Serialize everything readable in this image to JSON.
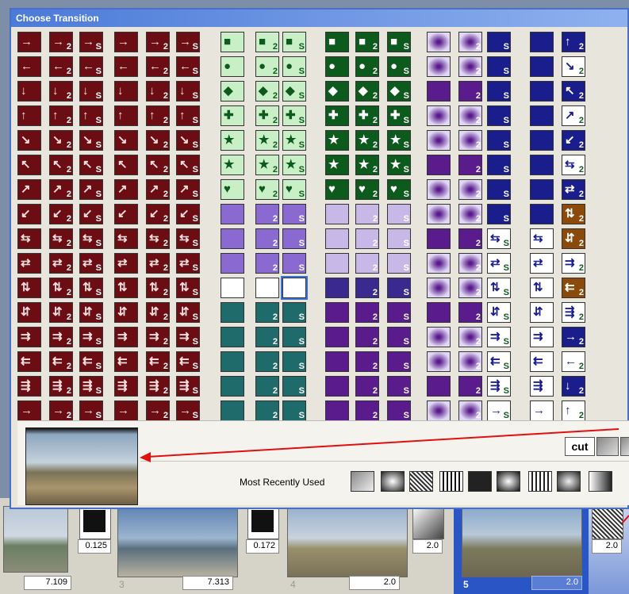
{
  "dialog": {
    "title": "Choose Transition"
  },
  "bottom": {
    "cut_label": "cut",
    "mru_label": "Most Recently Used"
  },
  "timeline": {
    "durations": [
      "7.109",
      "0.125",
      "7.313",
      "0.172",
      "2.0",
      "2.0",
      "2.0"
    ],
    "clip_numbers": [
      "3",
      "4",
      "5"
    ]
  },
  "colors": {
    "maroon": "#6b0d12",
    "pink": "#f7dede",
    "lightgreen": "#c9efc6",
    "darkgreen": "#0d5a1d",
    "purple": "#5a1b8c",
    "lavender": "#e0d8f4",
    "navy": "#1a1e8c",
    "teal": "#1f6a6a",
    "brown": "#8b4a0a",
    "title_blue": "#4b7ad8"
  },
  "icons": {
    "grid": "transition-icon",
    "preview": "preview-image",
    "arrow": "red-arrow"
  }
}
